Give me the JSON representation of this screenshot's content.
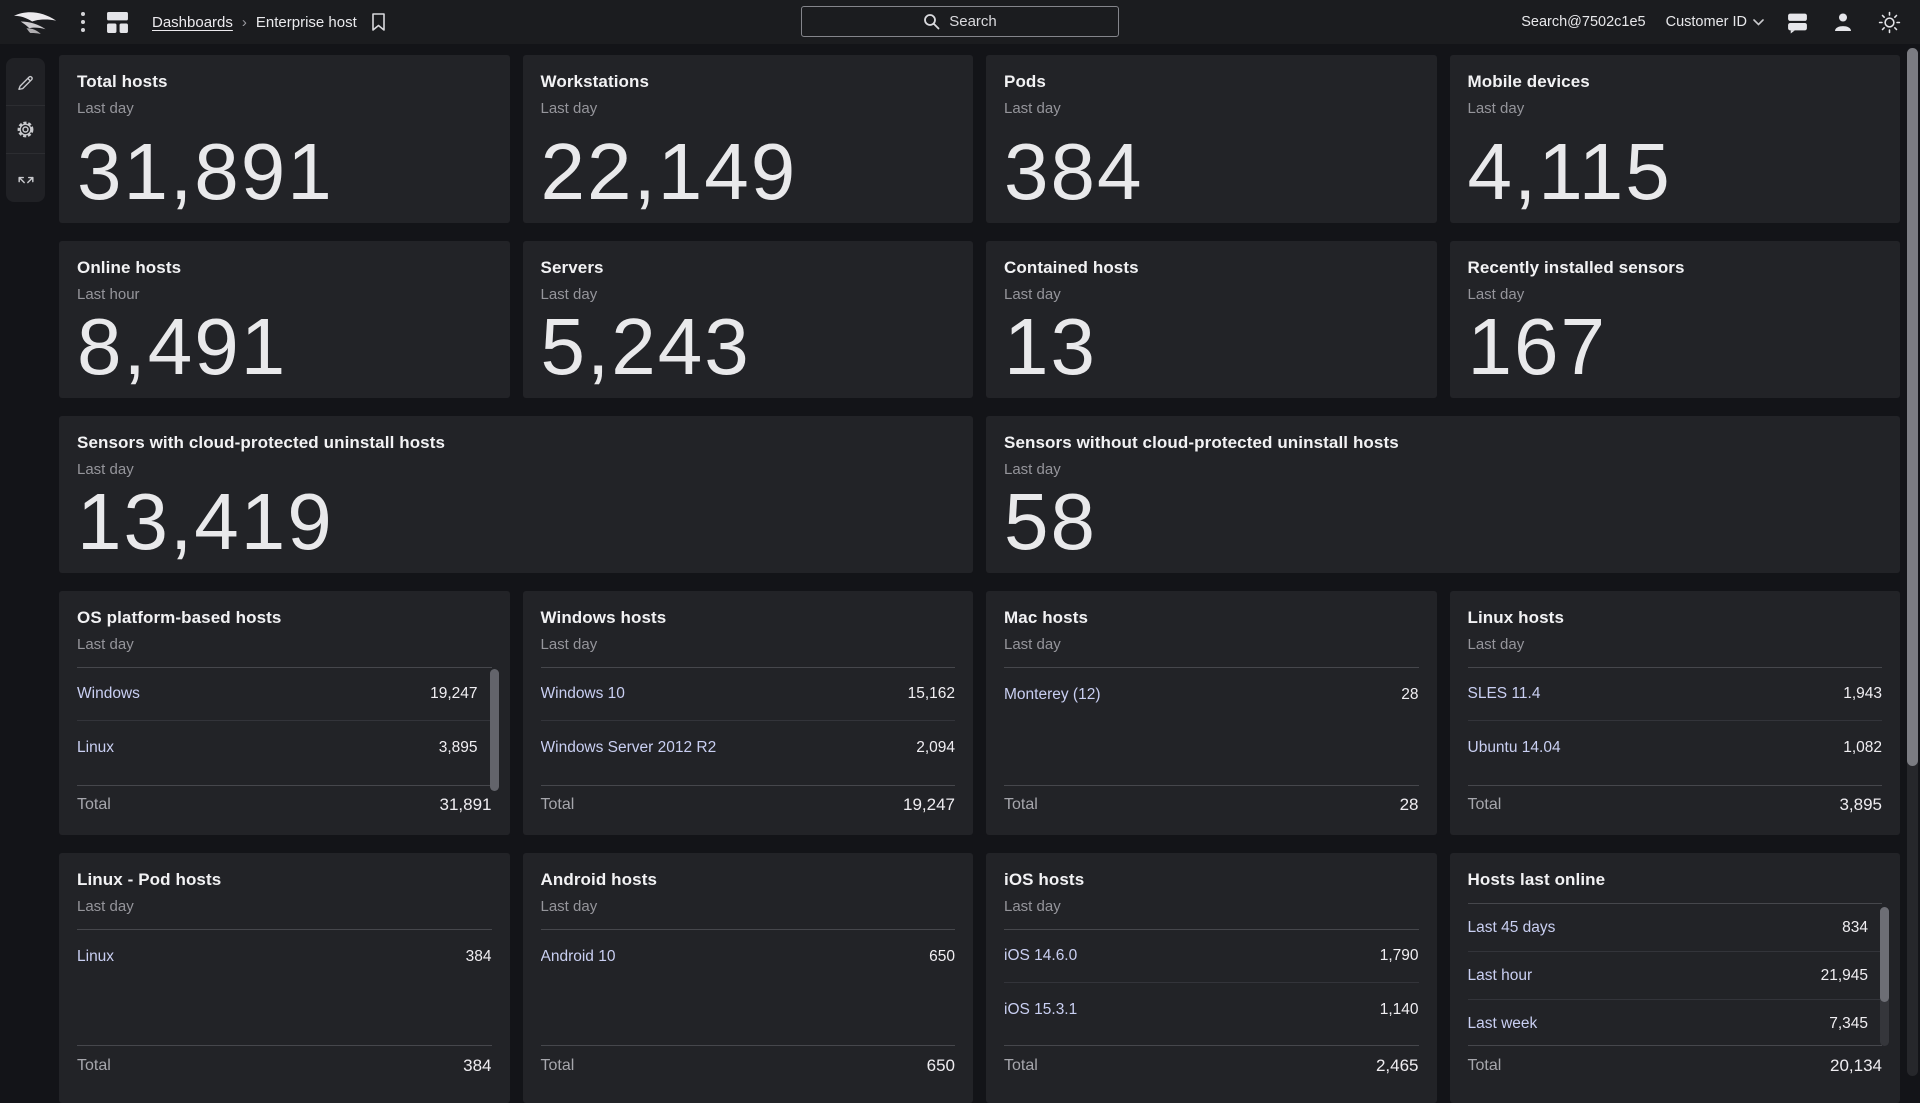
{
  "topbar": {
    "breadcrumb": {
      "root": "Dashboards",
      "separator": "›",
      "current": "Enterprise host"
    },
    "search": {
      "placeholder": "Search"
    },
    "user_search_scope": "Search@7502c1e5",
    "customer_id_label": "Customer ID"
  },
  "stat_cards": [
    {
      "title": "Total hosts",
      "period": "Last day",
      "value": "31,891"
    },
    {
      "title": "Workstations",
      "period": "Last day",
      "value": "22,149"
    },
    {
      "title": "Pods",
      "period": "Last day",
      "value": "384"
    },
    {
      "title": "Mobile devices",
      "period": "Last day",
      "value": "4,115"
    },
    {
      "title": "Online hosts",
      "period": "Last hour",
      "value": "8,491"
    },
    {
      "title": "Servers",
      "period": "Last day",
      "value": "5,243"
    },
    {
      "title": "Contained hosts",
      "period": "Last day",
      "value": "13"
    },
    {
      "title": "Recently installed sensors",
      "period": "Last day",
      "value": "167"
    }
  ],
  "wide_cards": [
    {
      "title": "Sensors with cloud-protected uninstall hosts",
      "period": "Last day",
      "value": "13,419"
    },
    {
      "title": "Sensors without cloud-protected uninstall hosts",
      "period": "Last day",
      "value": "58"
    }
  ],
  "table_cards": [
    {
      "title": "OS platform-based hosts",
      "period": "Last day",
      "total_label": "Total",
      "total": "31,891",
      "rows": [
        {
          "label": "Windows",
          "value": "19,247"
        },
        {
          "label": "Linux",
          "value": "3,895"
        }
      ]
    },
    {
      "title": "Windows hosts",
      "period": "Last day",
      "total_label": "Total",
      "total": "19,247",
      "rows": [
        {
          "label": "Windows 10",
          "value": "15,162"
        },
        {
          "label": "Windows Server 2012 R2",
          "value": "2,094"
        }
      ]
    },
    {
      "title": "Mac hosts",
      "period": "Last day",
      "total_label": "Total",
      "total": "28",
      "rows": [
        {
          "label": "Monterey (12)",
          "value": "28"
        }
      ]
    },
    {
      "title": "Linux hosts",
      "period": "Last day",
      "total_label": "Total",
      "total": "3,895",
      "rows": [
        {
          "label": "SLES 11.4",
          "value": "1,943"
        },
        {
          "label": "Ubuntu 14.04",
          "value": "1,082"
        }
      ]
    },
    {
      "title": "Linux - Pod hosts",
      "period": "Last day",
      "total_label": "Total",
      "total": "384",
      "rows": [
        {
          "label": "Linux",
          "value": "384"
        }
      ]
    },
    {
      "title": "Android hosts",
      "period": "Last day",
      "total_label": "Total",
      "total": "650",
      "rows": [
        {
          "label": "Android 10",
          "value": "650"
        }
      ]
    },
    {
      "title": "iOS hosts",
      "period": "Last day",
      "total_label": "Total",
      "total": "2,465",
      "rows": [
        {
          "label": "iOS 14.6.0",
          "value": "1,790"
        },
        {
          "label": "iOS 15.3.1",
          "value": "1,140"
        }
      ]
    },
    {
      "title": "Hosts last online",
      "total_label": "Total",
      "total": "20,134",
      "rows": [
        {
          "label": "Last 45 days",
          "value": "834"
        },
        {
          "label": "Last hour",
          "value": "21,945"
        },
        {
          "label": "Last week",
          "value": "7,345"
        }
      ]
    }
  ],
  "colors": {
    "page_bg": "#131418",
    "card_bg": "#222327",
    "link": "#c9cff2",
    "title": "#f2f2f4",
    "muted": "#95959b"
  }
}
